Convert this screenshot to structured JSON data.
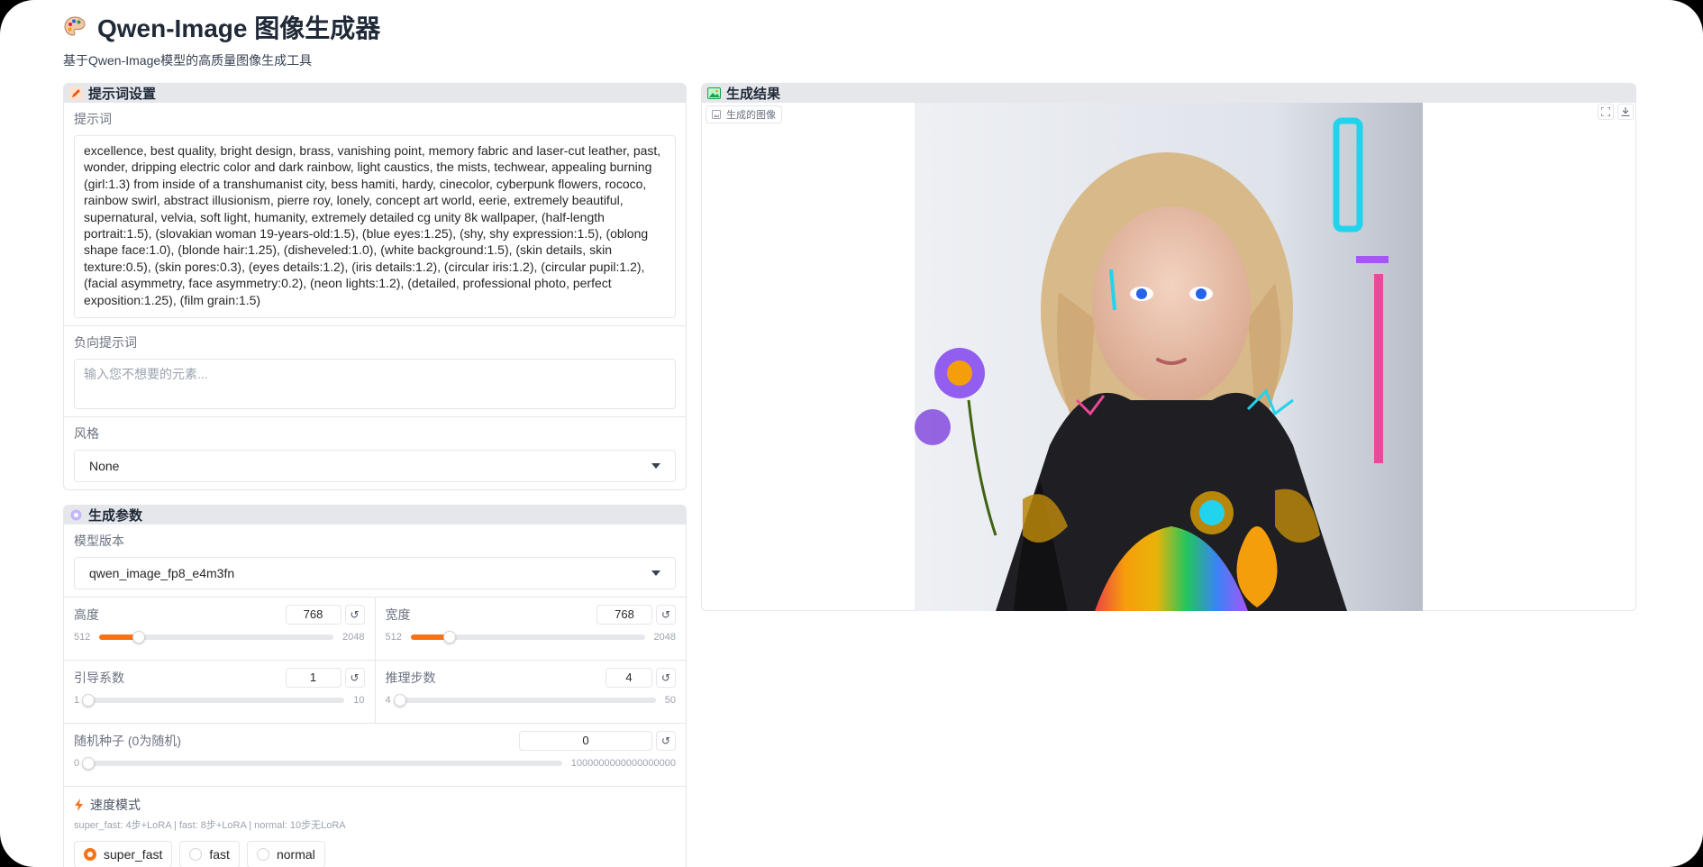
{
  "app": {
    "title": "Qwen-Image 图像生成器",
    "subtitle": "基于Qwen-Image模型的高质量图像生成工具"
  },
  "prompt_section": {
    "title": "提示词设置",
    "prompt_label": "提示词",
    "prompt_value": "excellence, best quality, bright design, brass, vanishing point, memory fabric and laser-cut leather, past, wonder, dripping electric color and dark rainbow, light caustics, the mists, techwear, appealing burning (girl:1.3) from inside of a transhumanist city, bess hamiti, hardy, cinecolor, cyberpunk flowers, rococo, rainbow swirl, abstract illusionism, pierre roy, lonely, concept art world, eerie, extremely beautiful, supernatural, velvia, soft light, humanity, extremely detailed cg unity 8k wallpaper, (half-length portrait:1.5), (slovakian  woman 19-years-old:1.5), (blue eyes:1.25), (shy, shy expression:1.5), (oblong shape face:1.0), (blonde hair:1.25), (disheveled:1.0), (white background:1.5), (skin details, skin texture:0.5), (skin pores:0.3), (eyes details:1.2), (iris details:1.2), (circular iris:1.2), (circular pupil:1.2), (facial asymmetry, face asymmetry:0.2), (neon lights:1.2), (detailed, professional photo, perfect exposition:1.25), (film grain:1.5)",
    "negative_label": "负向提示词",
    "negative_placeholder": "输入您不想要的元素...",
    "style_label": "风格",
    "style_value": "None"
  },
  "params_section": {
    "title": "生成参数",
    "model_label": "模型版本",
    "model_value": "qwen_image_fp8_e4m3fn",
    "height": {
      "label": "高度",
      "value": "768",
      "min": "512",
      "max": "2048",
      "fraction": 0.167
    },
    "width": {
      "label": "宽度",
      "value": "768",
      "min": "512",
      "max": "2048",
      "fraction": 0.167
    },
    "guidance": {
      "label": "引导系数",
      "value": "1",
      "min": "1",
      "max": "10",
      "fraction": 0.0
    },
    "steps": {
      "label": "推理步数",
      "value": "4",
      "min": "4",
      "max": "50",
      "fraction": 0.0
    },
    "seed": {
      "label": "随机种子 (0为随机)",
      "value": "0",
      "min": "0",
      "max": "1000000000000000000",
      "fraction": 0.0
    },
    "speed_label": "速度模式",
    "speed_desc": "super_fast: 4步+LoRA | fast: 8步+LoRA | normal: 10步无LoRA",
    "speed_options": [
      "super_fast",
      "fast",
      "normal"
    ],
    "speed_selected": "super_fast",
    "reset_glyph": "↺"
  },
  "result_section": {
    "title": "生成结果",
    "image_tag": "生成的图像"
  },
  "colors": {
    "accent": "#f97316",
    "panel_header": "#e5e7eb"
  }
}
